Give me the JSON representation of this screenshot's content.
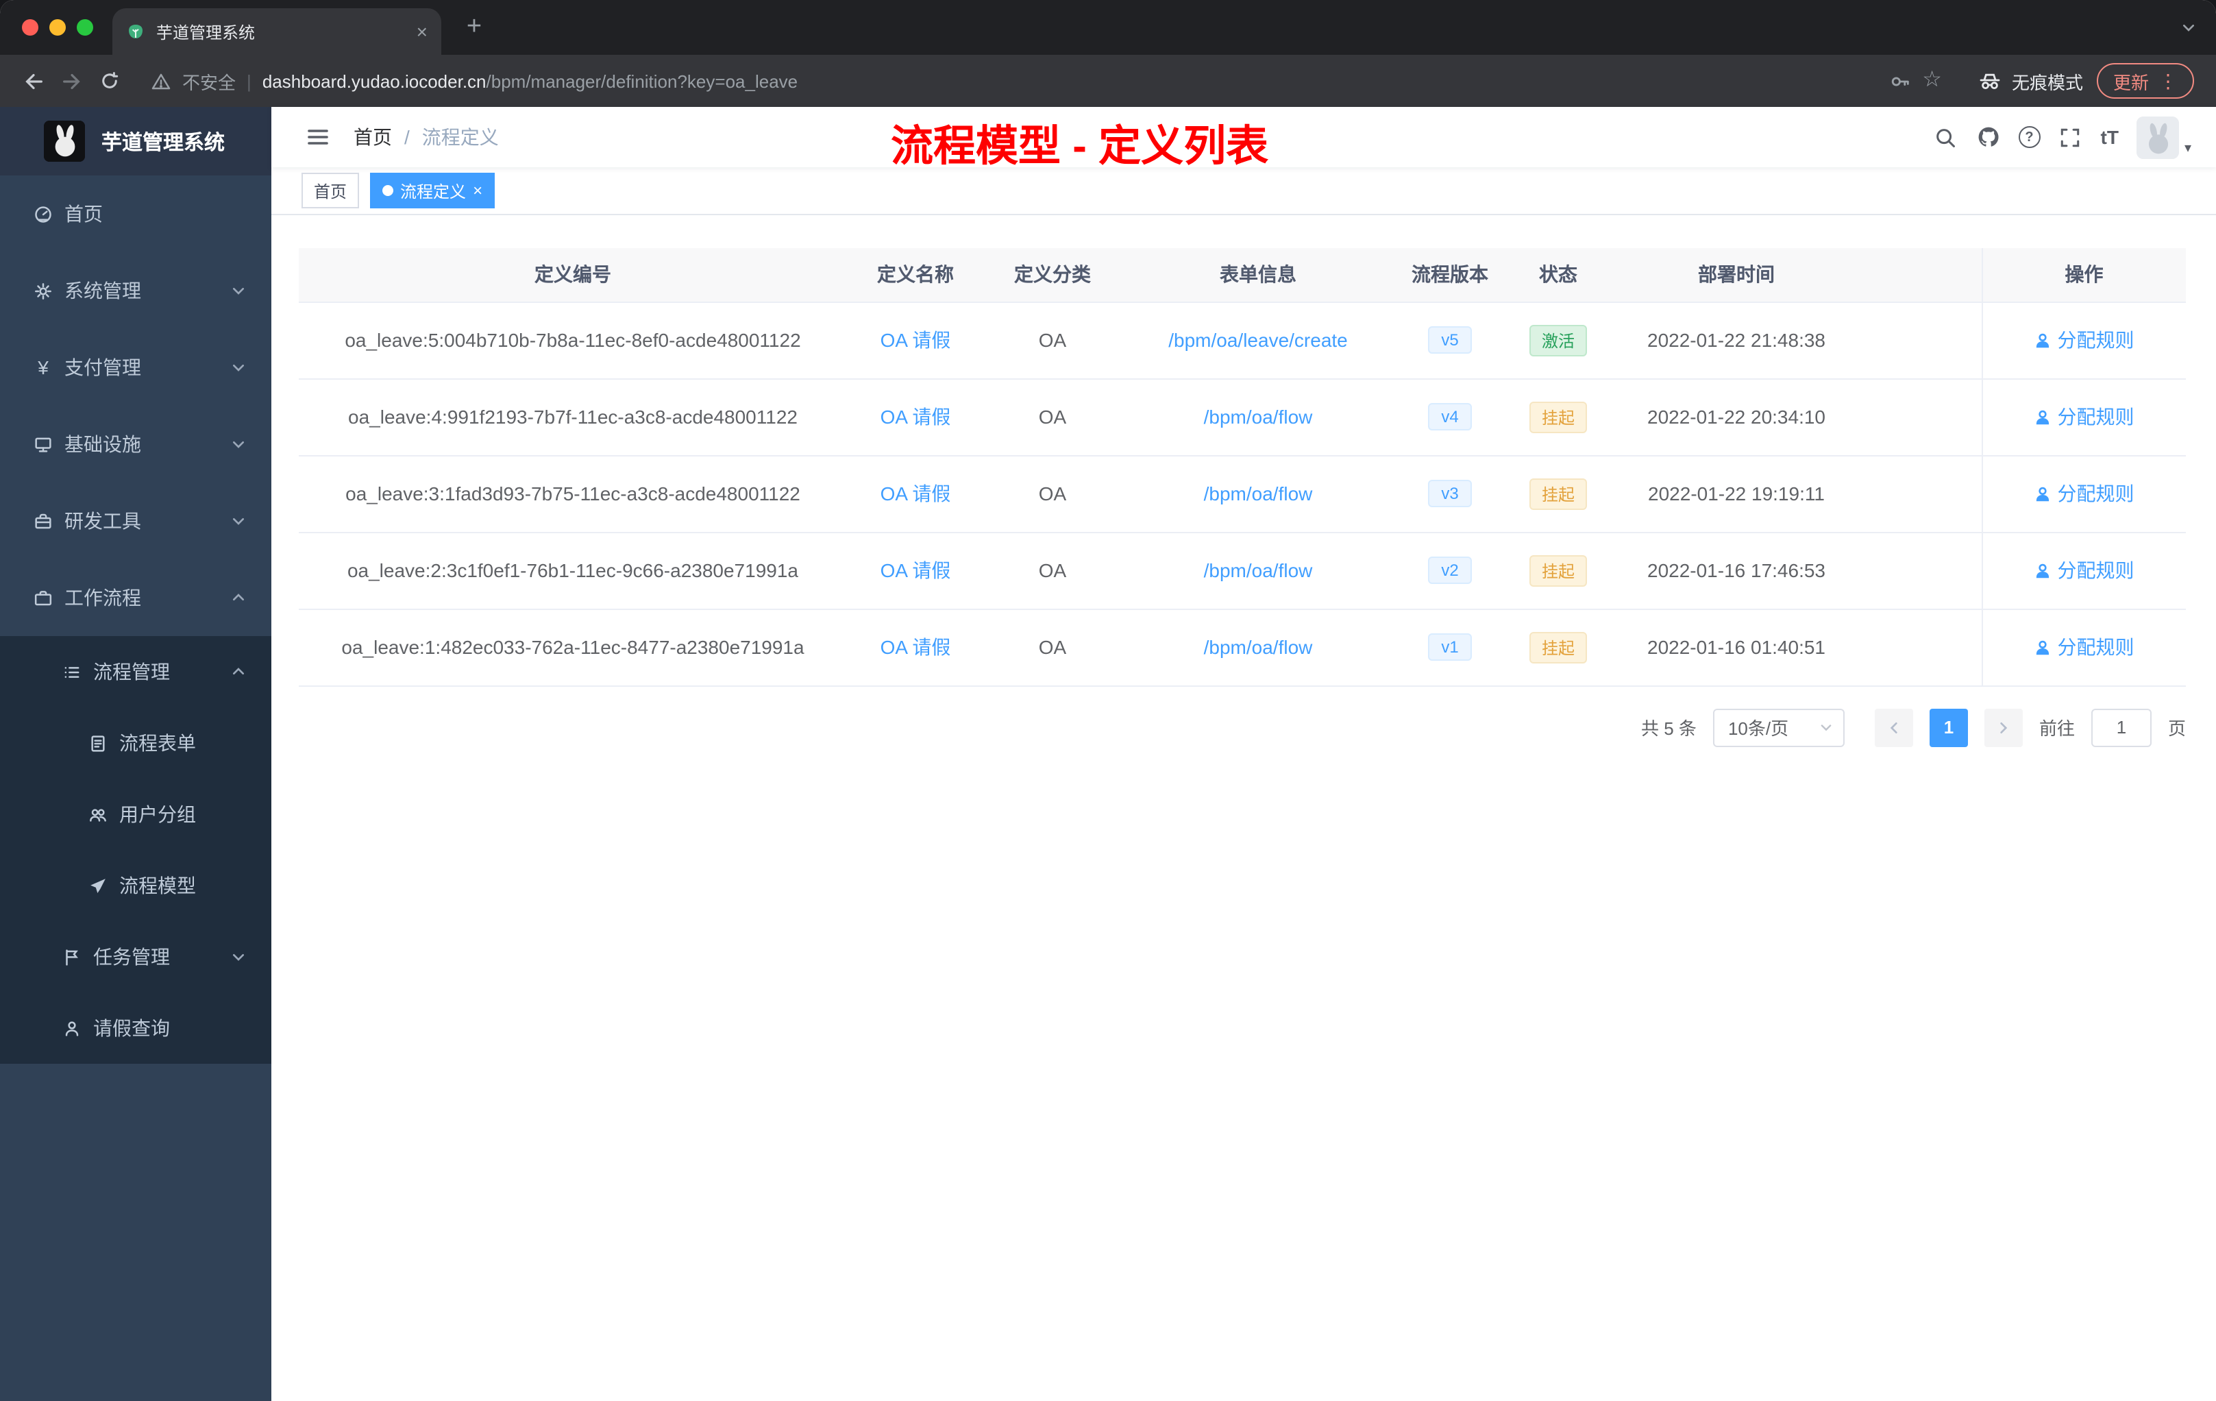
{
  "browser": {
    "tab_title": "芋道管理系统",
    "security_label": "不安全",
    "url_host": "dashboard.yudao.iocoder.cn",
    "url_path": "/bpm/manager/definition?key=oa_leave",
    "incognito_label": "无痕模式",
    "update_label": "更新"
  },
  "icons": {
    "plus": "+",
    "close": "×",
    "star": "☆",
    "dots": "⋮",
    "caret": "▾",
    "yen": "¥",
    "question": "?",
    "text_size": "tT"
  },
  "sidebar": {
    "logo_title": "芋道管理系统",
    "items": [
      {
        "label": "首页"
      },
      {
        "label": "系统管理"
      },
      {
        "label": "支付管理"
      },
      {
        "label": "基础设施"
      },
      {
        "label": "研发工具"
      },
      {
        "label": "工作流程"
      },
      {
        "label": "流程管理"
      },
      {
        "label": "流程表单"
      },
      {
        "label": "用户分组"
      },
      {
        "label": "流程模型"
      },
      {
        "label": "任务管理"
      },
      {
        "label": "请假查询"
      }
    ]
  },
  "header": {
    "breadcrumb": {
      "home": "首页",
      "separator": "/",
      "current": "流程定义"
    },
    "annotation": "流程模型 - 定义列表"
  },
  "tags": {
    "items": [
      {
        "label": "首页"
      },
      {
        "label": "流程定义"
      }
    ]
  },
  "table": {
    "columns": [
      "定义编号",
      "定义名称",
      "定义分类",
      "表单信息",
      "流程版本",
      "状态",
      "部署时间",
      "操作"
    ],
    "rows": [
      {
        "id": "oa_leave:5:004b710b-7b8a-11ec-8ef0-acde48001122",
        "name": "OA 请假",
        "category": "OA",
        "form": "/bpm/oa/leave/create",
        "version": "v5",
        "status": "激活",
        "status_type": "success",
        "deploy_time": "2022-01-22 21:48:38",
        "action": "分配规则"
      },
      {
        "id": "oa_leave:4:991f2193-7b7f-11ec-a3c8-acde48001122",
        "name": "OA 请假",
        "category": "OA",
        "form": "/bpm/oa/flow",
        "version": "v4",
        "status": "挂起",
        "status_type": "warning",
        "deploy_time": "2022-01-22 20:34:10",
        "action": "分配规则"
      },
      {
        "id": "oa_leave:3:1fad3d93-7b75-11ec-a3c8-acde48001122",
        "name": "OA 请假",
        "category": "OA",
        "form": "/bpm/oa/flow",
        "version": "v3",
        "status": "挂起",
        "status_type": "warning",
        "deploy_time": "2022-01-22 19:19:11",
        "action": "分配规则"
      },
      {
        "id": "oa_leave:2:3c1f0ef1-76b1-11ec-9c66-a2380e71991a",
        "name": "OA 请假",
        "category": "OA",
        "form": "/bpm/oa/flow",
        "version": "v2",
        "status": "挂起",
        "status_type": "warning",
        "deploy_time": "2022-01-16 17:46:53",
        "action": "分配规则"
      },
      {
        "id": "oa_leave:1:482ec033-762a-11ec-8477-a2380e71991a",
        "name": "OA 请假",
        "category": "OA",
        "form": "/bpm/oa/flow",
        "version": "v1",
        "status": "挂起",
        "status_type": "warning",
        "deploy_time": "2022-01-16 01:40:51",
        "action": "分配规则"
      }
    ]
  },
  "pagination": {
    "total": "共 5 条",
    "page_size": "10条/页",
    "current_page": "1",
    "goto_label": "前往",
    "goto_value": "1",
    "page_suffix": "页"
  },
  "colors": {
    "primary": "#409eff",
    "annotation_red": "#fe0000",
    "sidebar_bg": "#304156",
    "submenu_bg": "#1f2d3d",
    "success_text": "#26a05a",
    "warning_text": "#e3a23c"
  }
}
